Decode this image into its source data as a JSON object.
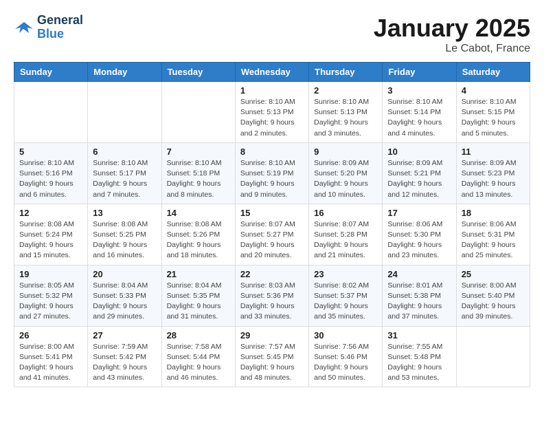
{
  "logo": {
    "line1": "General",
    "line2": "Blue"
  },
  "title": "January 2025",
  "subtitle": "Le Cabot, France",
  "weekdays": [
    "Sunday",
    "Monday",
    "Tuesday",
    "Wednesday",
    "Thursday",
    "Friday",
    "Saturday"
  ],
  "weeks": [
    [
      {
        "day": "",
        "info": ""
      },
      {
        "day": "",
        "info": ""
      },
      {
        "day": "",
        "info": ""
      },
      {
        "day": "1",
        "info": "Sunrise: 8:10 AM\nSunset: 5:13 PM\nDaylight: 9 hours\nand 2 minutes."
      },
      {
        "day": "2",
        "info": "Sunrise: 8:10 AM\nSunset: 5:13 PM\nDaylight: 9 hours\nand 3 minutes."
      },
      {
        "day": "3",
        "info": "Sunrise: 8:10 AM\nSunset: 5:14 PM\nDaylight: 9 hours\nand 4 minutes."
      },
      {
        "day": "4",
        "info": "Sunrise: 8:10 AM\nSunset: 5:15 PM\nDaylight: 9 hours\nand 5 minutes."
      }
    ],
    [
      {
        "day": "5",
        "info": "Sunrise: 8:10 AM\nSunset: 5:16 PM\nDaylight: 9 hours\nand 6 minutes."
      },
      {
        "day": "6",
        "info": "Sunrise: 8:10 AM\nSunset: 5:17 PM\nDaylight: 9 hours\nand 7 minutes."
      },
      {
        "day": "7",
        "info": "Sunrise: 8:10 AM\nSunset: 5:18 PM\nDaylight: 9 hours\nand 8 minutes."
      },
      {
        "day": "8",
        "info": "Sunrise: 8:10 AM\nSunset: 5:19 PM\nDaylight: 9 hours\nand 9 minutes."
      },
      {
        "day": "9",
        "info": "Sunrise: 8:09 AM\nSunset: 5:20 PM\nDaylight: 9 hours\nand 10 minutes."
      },
      {
        "day": "10",
        "info": "Sunrise: 8:09 AM\nSunset: 5:21 PM\nDaylight: 9 hours\nand 12 minutes."
      },
      {
        "day": "11",
        "info": "Sunrise: 8:09 AM\nSunset: 5:23 PM\nDaylight: 9 hours\nand 13 minutes."
      }
    ],
    [
      {
        "day": "12",
        "info": "Sunrise: 8:08 AM\nSunset: 5:24 PM\nDaylight: 9 hours\nand 15 minutes."
      },
      {
        "day": "13",
        "info": "Sunrise: 8:08 AM\nSunset: 5:25 PM\nDaylight: 9 hours\nand 16 minutes."
      },
      {
        "day": "14",
        "info": "Sunrise: 8:08 AM\nSunset: 5:26 PM\nDaylight: 9 hours\nand 18 minutes."
      },
      {
        "day": "15",
        "info": "Sunrise: 8:07 AM\nSunset: 5:27 PM\nDaylight: 9 hours\nand 20 minutes."
      },
      {
        "day": "16",
        "info": "Sunrise: 8:07 AM\nSunset: 5:28 PM\nDaylight: 9 hours\nand 21 minutes."
      },
      {
        "day": "17",
        "info": "Sunrise: 8:06 AM\nSunset: 5:30 PM\nDaylight: 9 hours\nand 23 minutes."
      },
      {
        "day": "18",
        "info": "Sunrise: 8:06 AM\nSunset: 5:31 PM\nDaylight: 9 hours\nand 25 minutes."
      }
    ],
    [
      {
        "day": "19",
        "info": "Sunrise: 8:05 AM\nSunset: 5:32 PM\nDaylight: 9 hours\nand 27 minutes."
      },
      {
        "day": "20",
        "info": "Sunrise: 8:04 AM\nSunset: 5:33 PM\nDaylight: 9 hours\nand 29 minutes."
      },
      {
        "day": "21",
        "info": "Sunrise: 8:04 AM\nSunset: 5:35 PM\nDaylight: 9 hours\nand 31 minutes."
      },
      {
        "day": "22",
        "info": "Sunrise: 8:03 AM\nSunset: 5:36 PM\nDaylight: 9 hours\nand 33 minutes."
      },
      {
        "day": "23",
        "info": "Sunrise: 8:02 AM\nSunset: 5:37 PM\nDaylight: 9 hours\nand 35 minutes."
      },
      {
        "day": "24",
        "info": "Sunrise: 8:01 AM\nSunset: 5:38 PM\nDaylight: 9 hours\nand 37 minutes."
      },
      {
        "day": "25",
        "info": "Sunrise: 8:00 AM\nSunset: 5:40 PM\nDaylight: 9 hours\nand 39 minutes."
      }
    ],
    [
      {
        "day": "26",
        "info": "Sunrise: 8:00 AM\nSunset: 5:41 PM\nDaylight: 9 hours\nand 41 minutes."
      },
      {
        "day": "27",
        "info": "Sunrise: 7:59 AM\nSunset: 5:42 PM\nDaylight: 9 hours\nand 43 minutes."
      },
      {
        "day": "28",
        "info": "Sunrise: 7:58 AM\nSunset: 5:44 PM\nDaylight: 9 hours\nand 46 minutes."
      },
      {
        "day": "29",
        "info": "Sunrise: 7:57 AM\nSunset: 5:45 PM\nDaylight: 9 hours\nand 48 minutes."
      },
      {
        "day": "30",
        "info": "Sunrise: 7:56 AM\nSunset: 5:46 PM\nDaylight: 9 hours\nand 50 minutes."
      },
      {
        "day": "31",
        "info": "Sunrise: 7:55 AM\nSunset: 5:48 PM\nDaylight: 9 hours\nand 53 minutes."
      },
      {
        "day": "",
        "info": ""
      }
    ]
  ]
}
